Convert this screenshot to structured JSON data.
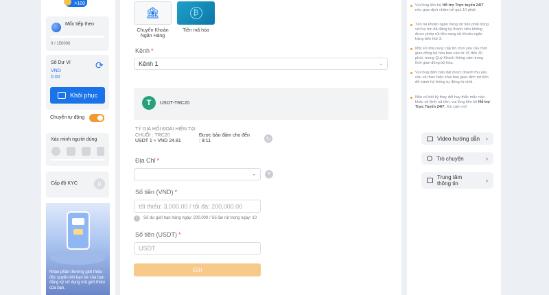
{
  "sidebar": {
    "badge": ">100",
    "milestone": {
      "label": "Mốc tiếp theo",
      "progress_text": "0 / 150000",
      "progress": 0
    },
    "balance": {
      "label": "Số Dư Ví",
      "currency": "VND",
      "amount": "0.00"
    },
    "restore_button": "Khôi phục",
    "auto_transfer": {
      "label": "Chuyển tự động",
      "enabled": true
    },
    "verify_label": "Xác minh người dùng",
    "kyc_label": "Cấp độ KYC",
    "promo_text": "Nhận phần thưởng giới thiệu độc quyền khi bạn bè của bạn đăng ký sử dụng mã giới thiệu của bạn."
  },
  "methods": [
    {
      "label": "Chuyển Khoản Ngân Hàng",
      "icon": "bank-icon",
      "active": false
    },
    {
      "label": "Tiền mã hóa",
      "icon": "bitcoin-icon",
      "active": true
    }
  ],
  "form": {
    "channel_label": "Kênh",
    "channel_value": "Kênh 1",
    "coin": "USDT-TRC20",
    "rate_title": "TỶ GIÁ HỐI ĐOÁI HIỆN TẠI",
    "rate_chain": "CHUỖI : TRC20",
    "rate_value": "USDT 1 ≈ VND 24.81",
    "rate_guarantee": "Được bảo đảm cho đến",
    "rate_time": ": 9:11",
    "address_label": "Địa Chỉ",
    "amount_vnd_label": "Số tiền (VND)",
    "amount_vnd_placeholder": "tối thiểu: 3,000.00 / tối đa: 200,000.00",
    "limit_note": "Số dư giới hạn hàng ngày: 200,000 / Số lần rút trong ngày: 10",
    "amount_usdt_label": "Số tiền (USDT)",
    "amount_usdt_placeholder": "USDT",
    "submit": "Gửi"
  },
  "right": {
    "tips": [
      {
        "pre": "Vui lòng liên hệ ",
        "bold": "Hỗ trợ Trực tuyến 24/7",
        "post": " nếu giao dịch chậm trễ quá 10 phút."
      },
      {
        "pre": "Tên tài khoản ngân hàng rút tiền phải trùng với họ tên đã đăng ký thành viên không được phép rút tiền sang tài khoản ngân hàng bên thứ 3.",
        "bold": "",
        "post": ""
      },
      {
        "pre": "Một số nhà cung cấp trò chơi yêu cầu thời gian đồng bộ hóa bảo cáo từ 15 đến 30 phút, mong Quý Khách thông cảm trong thời gian đồng bộ hóa.",
        "bold": "",
        "post": ""
      },
      {
        "pre": "Vui lòng đảm bảo đạt được doanh thu yêu cầu và thực hiện khai báo giao dịch rút tiền để tránh hệ thống tự động từ chối.",
        "bold": "",
        "post": ""
      },
      {
        "pre": "Nếu có bất kỳ thay đổi hay thắc mắc nào khác về lệnh rút tiền, vui lòng liên hệ ",
        "bold": "Hỗ trợ Trực Tuyến 24/7",
        "post": ". Xin cảm ơn!"
      }
    ],
    "buttons": [
      "Video hướng dẫn",
      "Trò chuyện",
      "Trung tâm thông tin"
    ]
  },
  "colors": {
    "accent": "#1a73e8",
    "orange": "#f29a2e",
    "teal": "#26a17b",
    "submit": "#f7c98b"
  }
}
